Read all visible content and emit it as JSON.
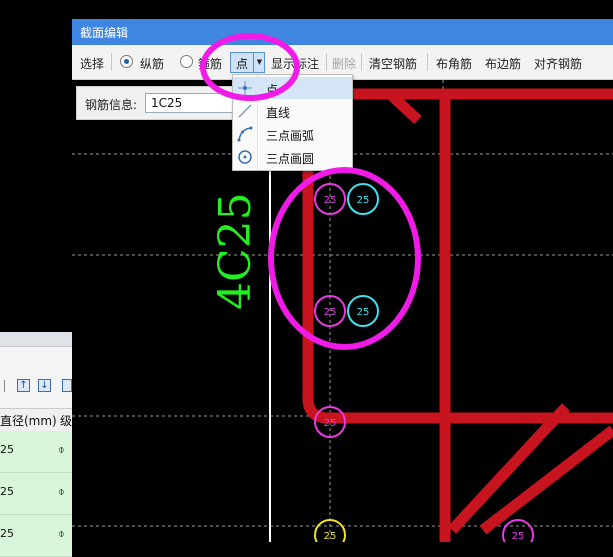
{
  "window": {
    "title": "截面编辑"
  },
  "toolbar": {
    "select": "选择",
    "longitudinal": "纵筋",
    "stirrup": "箍筋",
    "point": "点",
    "show_annotation": "显示标注",
    "delete": "删除",
    "clear_rebar": "清空钢筋",
    "corner_rebar": "布角筋",
    "edge_rebar": "布边筋",
    "align_rebar": "对齐钢筋"
  },
  "rebar_info": {
    "label": "钢筋信息:",
    "value": "1C25"
  },
  "dropdown": {
    "items": [
      "点",
      "直线",
      "三点画弧",
      "三点画圆"
    ]
  },
  "canvas": {
    "dimension_text": "4C25",
    "bar_labels": [
      "25",
      "25",
      "25",
      "25",
      "25",
      "25",
      "25"
    ]
  },
  "background_table": {
    "col_diameter": "直径(mm)",
    "col_grade": "级",
    "rows": [
      {
        "diameter": "25",
        "grade": "⌽"
      },
      {
        "diameter": "25",
        "grade": "⌽"
      },
      {
        "diameter": "25",
        "grade": "⌽"
      }
    ]
  },
  "colors": {
    "title_bar": "#3f86e0",
    "rebar_red": "#c8141e",
    "annotation_magenta": "#f11be8",
    "dimension_green": "#22ee22",
    "bar_cyan": "#3ee0ee",
    "bar_magenta": "#e63ce0",
    "bar_yellow": "#f0e020"
  }
}
